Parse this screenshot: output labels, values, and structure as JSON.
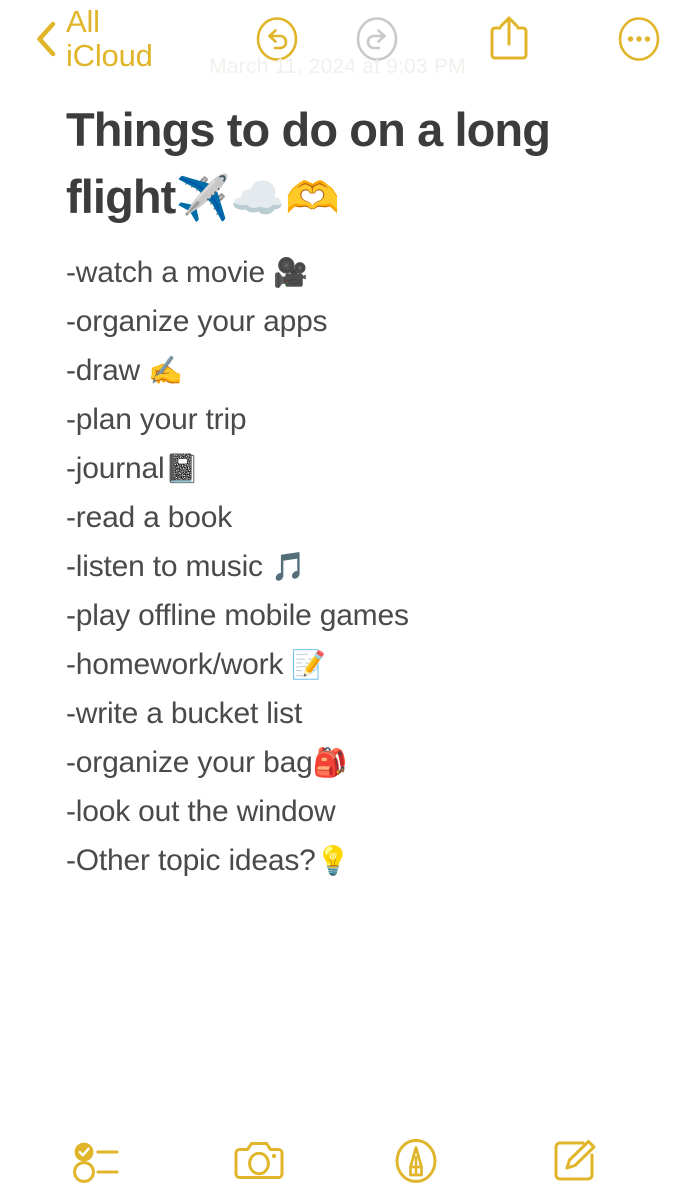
{
  "app": {
    "name": "Notes",
    "accent_color": "#E0B529",
    "disabled_color": "#C9C9C9",
    "background_color": "#FFFFFF",
    "title_color": "#3C3C3C",
    "body_text_color": "#4A4A4A"
  },
  "topbar": {
    "back_label": "All iCloud",
    "back_icon": "chevron-left-icon",
    "timestamp": "March 11, 2024 at 9:03 PM",
    "actions": [
      {
        "name": "undo-button",
        "icon": "undo-circle-icon",
        "label": "Undo",
        "enabled": true
      },
      {
        "name": "redo-button",
        "icon": "redo-circle-icon",
        "label": "Redo",
        "enabled": false
      },
      {
        "name": "share-button",
        "icon": "share-icon",
        "label": "Share",
        "enabled": true
      },
      {
        "name": "more-button",
        "icon": "more-circle-icon",
        "label": "More",
        "enabled": true
      }
    ]
  },
  "note": {
    "title_text": "Things to do on a long flight",
    "title_emoji": "✈️☁️🫶",
    "lines": [
      {
        "text": "-watch a movie ",
        "emoji": "🎥"
      },
      {
        "text": "-organize your apps",
        "emoji": ""
      },
      {
        "text": "-draw ",
        "emoji": "✍️"
      },
      {
        "text": "-plan your trip",
        "emoji": ""
      },
      {
        "text": "-journal",
        "emoji": "📓"
      },
      {
        "text": "-read a book",
        "emoji": ""
      },
      {
        "text": "-listen to music ",
        "emoji": "🎵"
      },
      {
        "text": "-play offline mobile games",
        "emoji": ""
      },
      {
        "text": "-homework/work ",
        "emoji": "📝"
      },
      {
        "text": "-write a bucket list",
        "emoji": ""
      },
      {
        "text": "-organize your bag",
        "emoji": "🎒"
      },
      {
        "text": "-look out the window",
        "emoji": ""
      },
      {
        "text": "-Other topic ideas?",
        "emoji": "💡"
      }
    ]
  },
  "bottombar": {
    "actions": [
      {
        "name": "checklist-button",
        "icon": "checklist-icon",
        "label": "Checklist"
      },
      {
        "name": "camera-button",
        "icon": "camera-icon",
        "label": "Camera"
      },
      {
        "name": "markup-button",
        "icon": "markup-pen-icon",
        "label": "Markup"
      },
      {
        "name": "compose-button",
        "icon": "compose-icon",
        "label": "New Note"
      }
    ]
  }
}
